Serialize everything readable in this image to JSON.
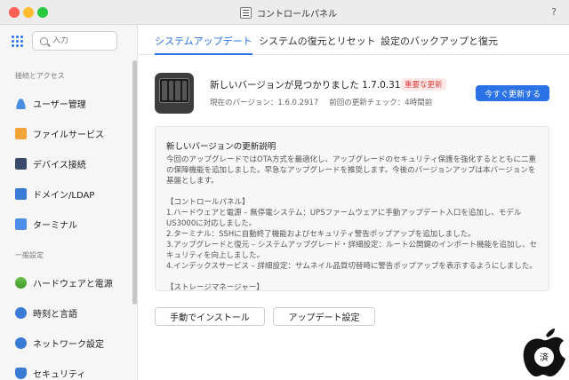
{
  "window": {
    "title": "コントロールパネル",
    "help": "?"
  },
  "sidebar": {
    "search_placeholder": "入力",
    "section_1": "接続とアクセス",
    "section_2": "一般設定",
    "items": [
      {
        "label": "ユーザー管理",
        "icon": "user-icon"
      },
      {
        "label": "ファイルサービス",
        "icon": "folder-icon"
      },
      {
        "label": "デバイス接続",
        "icon": "device-icon"
      },
      {
        "label": "ドメイン/LDAP",
        "icon": "domain-icon"
      },
      {
        "label": "ターミナル",
        "icon": "terminal-icon"
      },
      {
        "label": "ハードウェアと電源",
        "icon": "hardware-icon"
      },
      {
        "label": "時刻と言語",
        "icon": "clock-icon"
      },
      {
        "label": "ネットワーク設定",
        "icon": "network-icon"
      },
      {
        "label": "セキュリティ",
        "icon": "security-icon"
      }
    ]
  },
  "tabs": [
    {
      "label": "システムアップデート",
      "active": true
    },
    {
      "label": "システムの復元とリセット",
      "active": false
    },
    {
      "label": "設定のバックアップと復元",
      "active": false
    }
  ],
  "update": {
    "title": "新しいバージョンが見つかりました 1.7.0.3125",
    "badge": "重要な更新",
    "current_version": "現在のバージョン：1.6.0.2917",
    "last_check": "前回の更新チェック：4時間前",
    "update_button": "今すぐ更新する"
  },
  "notes": {
    "title": "新しいバージョンの更新説明",
    "body": "今回のアップグレードではOTA方式を最適化し、アップグレードのセキュリティ保護を強化するとともに二重の保障機能を追加しました。早急なアップグレードを推奨します。今後のバージョンアップは本バージョンを基盤とします。\n\n【コントロールパネル】\n1.ハードウェアと電源 – 無停電システム：UPSファームウェアに手動アップデート入口を追加し、モデルUS3000に対応しました。\n2.ターミナル：SSHに自動終了機能およびセキュリティ警告ポップアップを追加しました。\n3.アップグレードと復元 – システムアップグレード・詳細設定：ルート公開鍵のインポート機能を追加し、セキュリティを向上しました。\n4.インデックスサービス – 詳細設定：サムネイル品質切替時に警告ポップアップを表示するようにしました。\n\n【ストレージマネージャー】"
  },
  "actions": {
    "manual_install": "手動でインストール",
    "update_settings": "アップデート設定"
  },
  "watermark": {
    "text": "濃済定"
  },
  "colors": {
    "accent": "#2a72e6",
    "badge_text": "#d9403a"
  }
}
